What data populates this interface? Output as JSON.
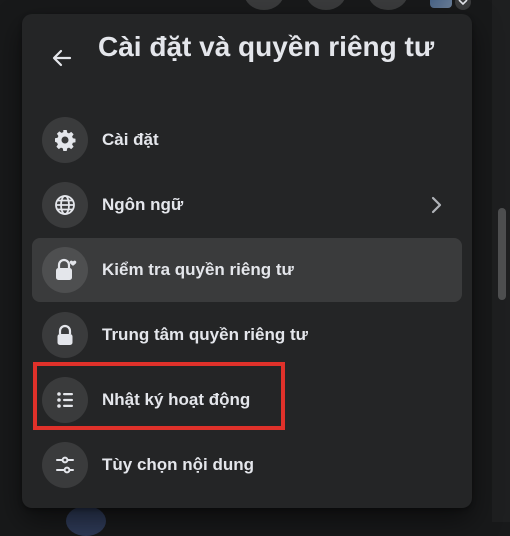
{
  "panel": {
    "title": "Cài đặt và quyền riêng tư",
    "items": [
      {
        "label": "Cài đặt",
        "icon": "gear-icon"
      },
      {
        "label": "Ngôn ngữ",
        "icon": "globe-icon",
        "has_submenu": true
      },
      {
        "label": "Kiểm tra quyền riêng tư",
        "icon": "lock-heart-icon",
        "highlighted": true
      },
      {
        "label": "Trung tâm quyền riêng tư",
        "icon": "lock-icon"
      },
      {
        "label": "Nhật ký hoạt động",
        "icon": "list-icon",
        "annotated": true
      },
      {
        "label": "Tùy chọn nội dung",
        "icon": "sliders-icon"
      }
    ]
  },
  "colors": {
    "background": "#18191a",
    "panel": "#242526",
    "hover": "#3a3b3c",
    "text": "#e4e6eb",
    "annotation": "#e0312a"
  }
}
